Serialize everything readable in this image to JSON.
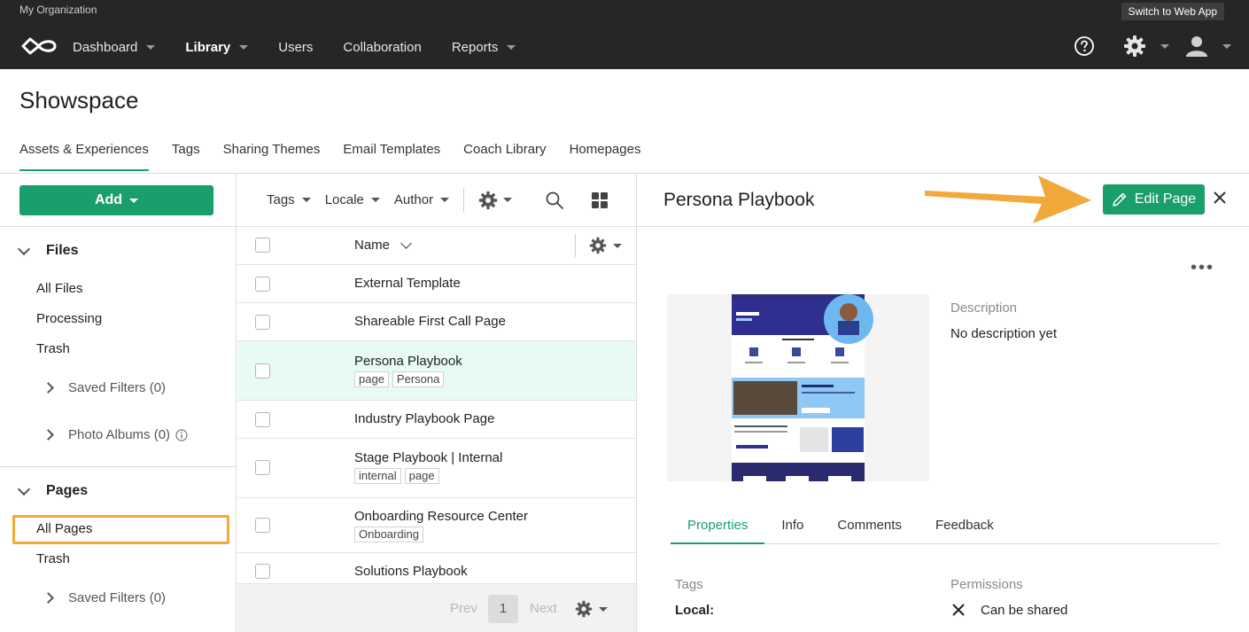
{
  "topbar": {
    "org": "My Organization",
    "switch_label": "Switch to Web App",
    "nav": [
      {
        "label": "Dashboard"
      },
      {
        "label": "Library"
      },
      {
        "label": "Users"
      },
      {
        "label": "Collaboration"
      },
      {
        "label": "Reports"
      }
    ]
  },
  "header": {
    "title": "Showspace",
    "tabs": [
      {
        "label": "Assets & Experiences"
      },
      {
        "label": "Tags"
      },
      {
        "label": "Sharing Themes"
      },
      {
        "label": "Email Templates"
      },
      {
        "label": "Coach Library"
      },
      {
        "label": "Homepages"
      }
    ]
  },
  "sidebar": {
    "add_label": "Add",
    "files": {
      "title": "Files",
      "items": [
        "All Files",
        "Processing",
        "Trash"
      ],
      "saved_filters": "Saved Filters (0)",
      "photo_albums": "Photo Albums (0)"
    },
    "pages": {
      "title": "Pages",
      "items": [
        "All Pages",
        "Trash"
      ],
      "saved_filters": "Saved Filters (0)"
    }
  },
  "list": {
    "filters": {
      "tags": "Tags",
      "locale": "Locale",
      "author": "Author"
    },
    "column_name": "Name",
    "rows": [
      {
        "name": "External Template",
        "tags": []
      },
      {
        "name": "Shareable First Call Page",
        "tags": []
      },
      {
        "name": "Persona Playbook",
        "tags": [
          "page",
          "Persona"
        ]
      },
      {
        "name": "Industry Playbook Page",
        "tags": []
      },
      {
        "name": "Stage Playbook | Internal",
        "tags": [
          "internal",
          "page"
        ]
      },
      {
        "name": "Onboarding Resource Center",
        "tags": [
          "Onboarding"
        ]
      },
      {
        "name": "Solutions Playbook",
        "tags": []
      }
    ],
    "pager": {
      "prev": "Prev",
      "page": "1",
      "next": "Next"
    }
  },
  "detail": {
    "title": "Persona Playbook",
    "edit_label": "Edit Page",
    "description_label": "Description",
    "description_value": "No description yet",
    "tabs": [
      {
        "label": "Properties"
      },
      {
        "label": "Info"
      },
      {
        "label": "Comments"
      },
      {
        "label": "Feedback"
      }
    ],
    "tags_label": "Tags",
    "local_label": "Local:",
    "permissions_label": "Permissions",
    "permission_value": "Can be shared"
  },
  "colors": {
    "topbar": "#262626",
    "accent": "#1a9e6c",
    "highlight": "#f2a93b",
    "selected_row": "#e7faf3"
  }
}
